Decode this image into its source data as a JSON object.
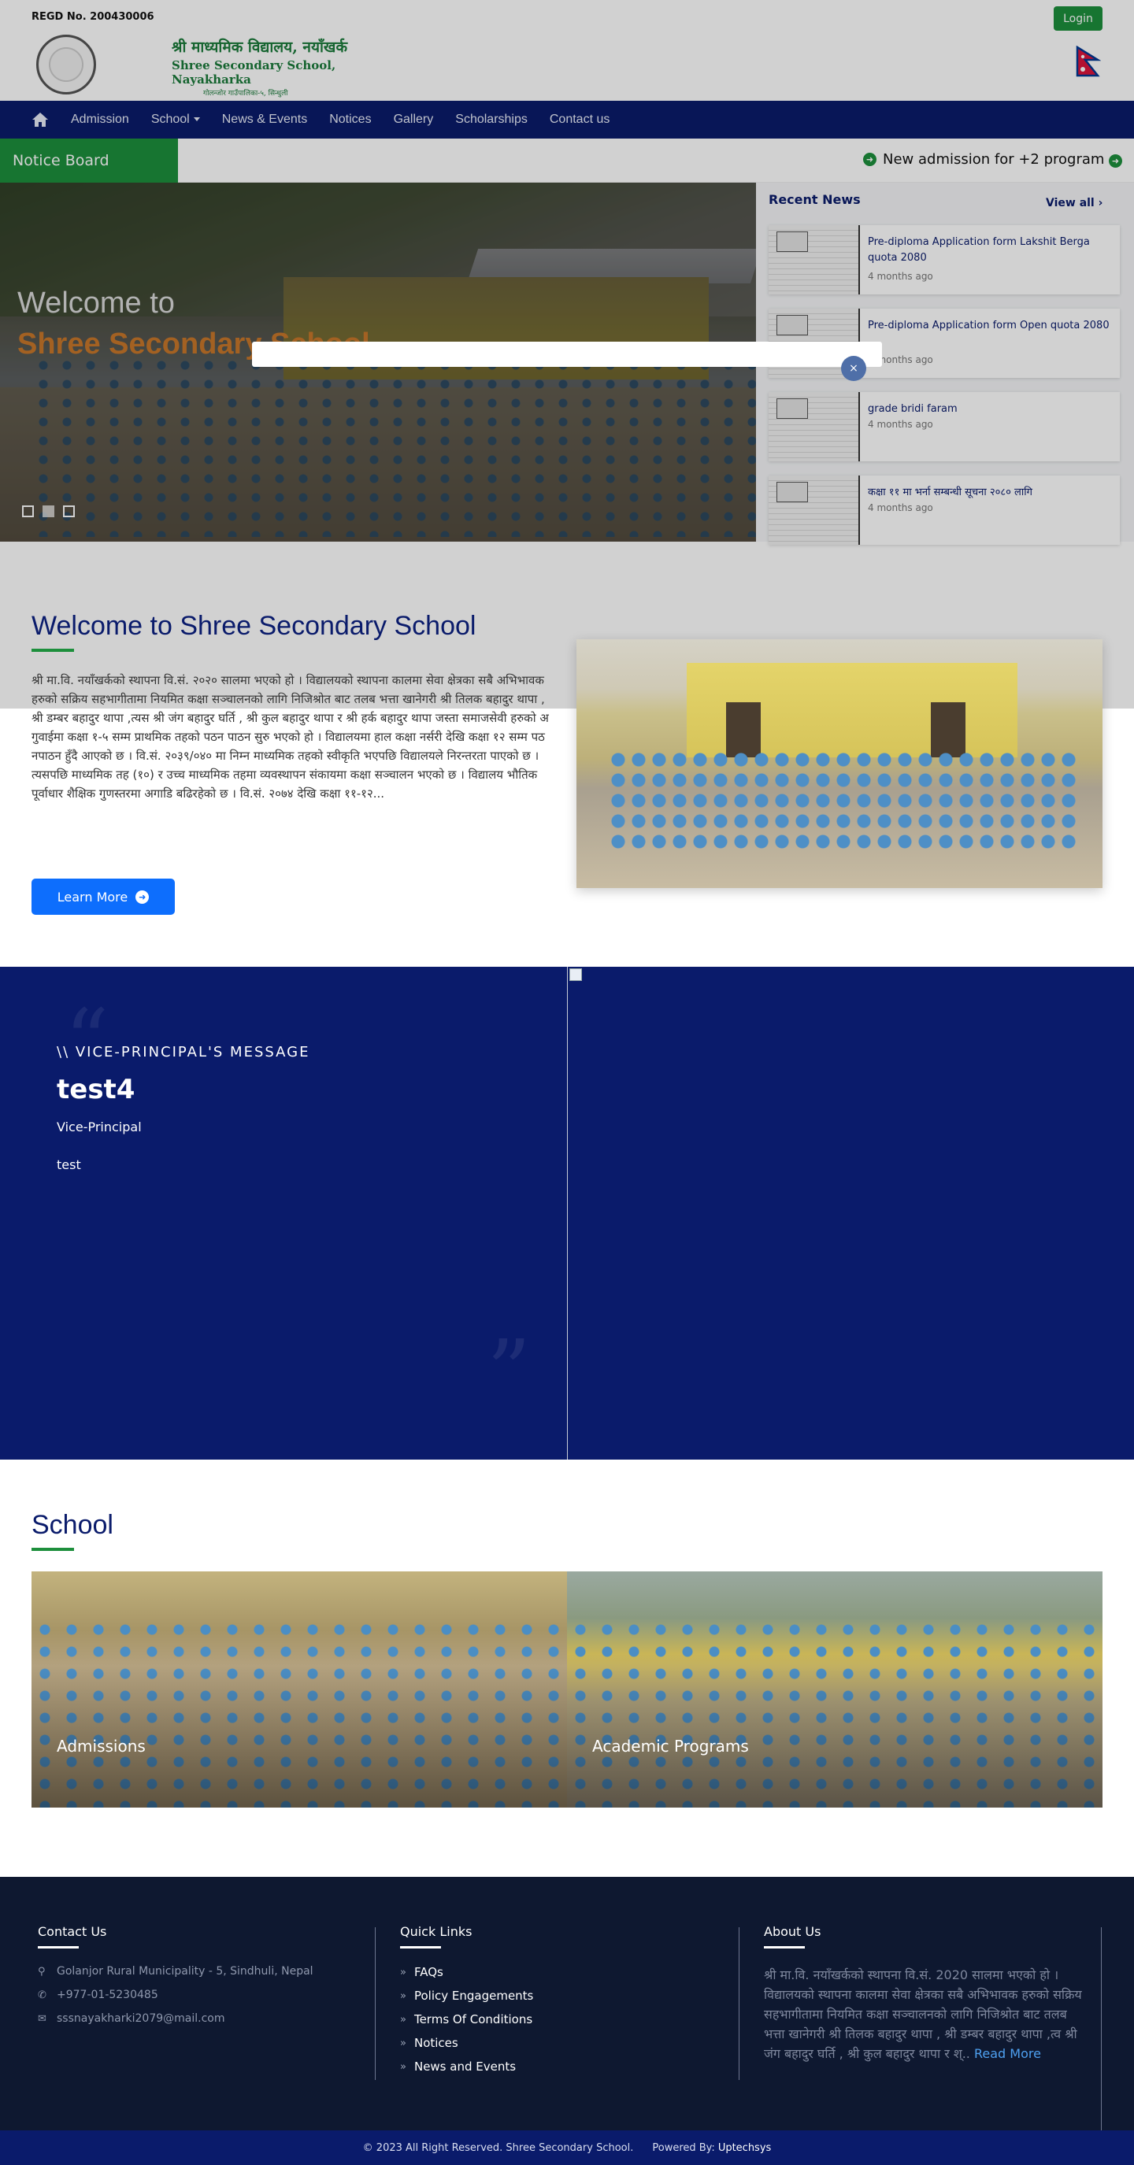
{
  "header": {
    "regd": "REGD No. 200430006",
    "login_label": "Login",
    "logo_np": "श्री माध्यमिक विद्यालय, नयाँखर्क",
    "logo_en": "Shree Secondary School, Nayakharka",
    "logo_addr": "गोलन्जोर गाउँपालिका-५, सिन्धुली"
  },
  "nav": {
    "home_icon": "home-icon",
    "items": [
      "Admission",
      "School",
      "News & Events",
      "Notices",
      "Gallery",
      "Scholarships",
      "Contact us"
    ]
  },
  "notice": {
    "label": "Notice Board",
    "item": "New admission for +2 program"
  },
  "hero": {
    "welcome": "Welcome to",
    "school": "Shree Secondary School",
    "slides": 3,
    "active_slide": 2
  },
  "news": {
    "title": "Recent News",
    "view_all": "View all",
    "items": [
      {
        "title": "Pre-diploma Application form Lakshit Berga quota 2080",
        "time": "4 months ago"
      },
      {
        "title": "Pre-diploma Application form Open quota 2080",
        "time": "4 months ago"
      },
      {
        "title": "grade bridi faram",
        "time": "4 months ago"
      },
      {
        "title": "कक्षा ११ मा भर्ना सम्बन्धी सूचना २०८० लागि",
        "time": "4 months ago"
      }
    ]
  },
  "modal": {
    "close": "×"
  },
  "welcome": {
    "title": "Welcome to Shree Secondary School",
    "text": "श्री मा.वि. नयाँखर्कको स्थापना वि.सं. २०२० सालमा भएको हो । विद्यालयको स्थापना कालमा सेवा क्षेत्रका सबै अभिभावक हरुको सक्रिय सहभागीतामा नियमित कक्षा सञ्चालनको लागि निजिश्रोत बाट तलब भत्ता खानेगरी श्री तिलक बहादुर थापा , श्री डम्बर बहादुर थापा ,त्यस श्री जंग बहादुर घर्ति , श्री कुल बहादुर थापा  र श्री हर्क बहादुर थापा जस्ता समाजसेवी हरुको अगुवाईमा कक्षा १-५ सम्म प्राथमिक तहको पठन पाठन सुरु भएको हो । विद्यालयमा हाल कक्षा नर्सरी देखि कक्षा १२ सम्म पठनपाठन हुँदै आएको छ । वि.सं. २०३९/०४० मा निम्न माध्यमिक तहको स्वीकृति भएपछि विद्यालयले निरन्तरता पाएको छ । त्यसपछि माध्यमिक तह (१०) र उच्च माध्यमिक तहमा व्यवस्थापन संकायमा कक्षा सञ्चालन भएको छ । विद्यालय भौतिक पूर्वाधार शैक्षिक गुणस्तरमा अगाडि बढिरहेको छ । वि.सं. २०७४ देखि कक्षा ११-१२...",
    "learn_more": "Learn More"
  },
  "vice_principal": {
    "kicker": "\\\\ VICE-PRINCIPAL'S MESSAGE",
    "name": "test4",
    "role": "Vice-Principal",
    "message": "test"
  },
  "school": {
    "title": "School",
    "tiles": [
      "Admissions",
      "Academic Programs"
    ]
  },
  "footer": {
    "contact_title": "Contact Us",
    "address": "Golanjor Rural Municipality - 5, Sindhuli, Nepal",
    "phone": "+977-01-5230485",
    "email": "sssnayakharki2079@mail.com",
    "links_title": "Quick Links",
    "links": [
      "FAQs",
      "Policy Engagements",
      "Terms Of Conditions",
      "Notices",
      "News and Events"
    ],
    "about_title": "About Us",
    "about_text": "श्री मा.वि. नयाँखर्कको स्थापना वि.सं. 2020 सालमा भएको हो । विद्यालयको स्थापना कालमा सेवा क्षेत्रका सबै अभिभावक हरुको सक्रिय सहभागीतामा नियमित कक्षा सञ्चालनको लागि निजिश्रोत बाट तलब भत्ता खानेगरी श्री तिलक बहादुर थापा , श्री डम्बर बहादुर थापा ,त्व श्री जंग बहादुर घर्ति , श्री कुल बहादुर थापा  र श्..",
    "read_more": "Read More",
    "copyright": "© 2023 All Right Reserved. Shree Secondary School.",
    "powered_by": "Powered By:",
    "brand": "Uptechsys"
  },
  "colors": {
    "navy": "#0a1b6b",
    "green": "#1d8f3c",
    "footer": "#0e1830",
    "orange": "#c7772a",
    "link_blue": "#4ea0f0"
  }
}
